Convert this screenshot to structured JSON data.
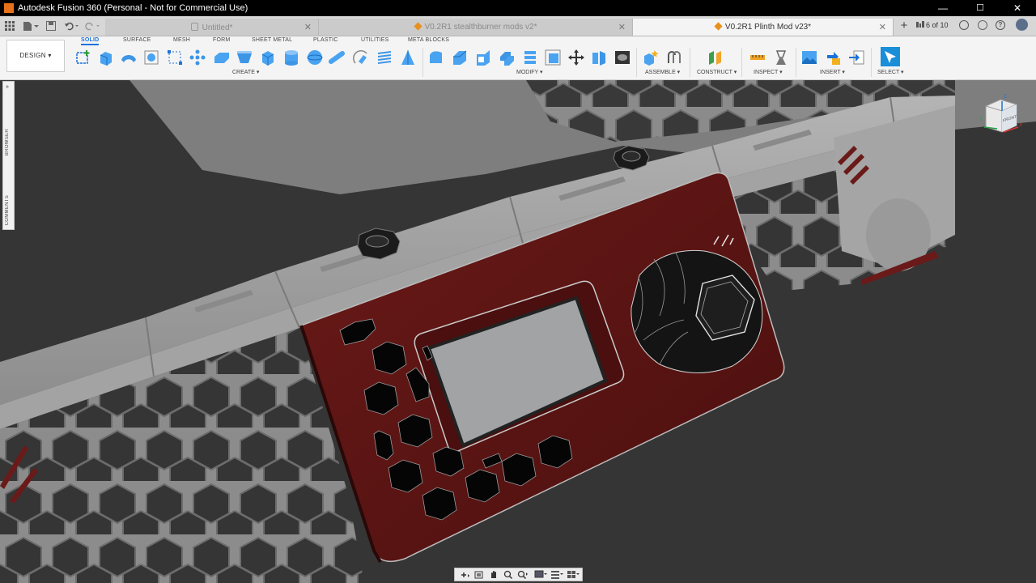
{
  "window": {
    "title": "Autodesk Fusion 360 (Personal - Not for Commercial Use)",
    "controls": {
      "minimize": "—",
      "maximize": "☐",
      "close": "✕"
    }
  },
  "tabbar": {
    "tabs": [
      {
        "label": "Untitled*",
        "icon": "lock-icon",
        "active": false
      },
      {
        "label": "V0.2R1 stealthburner mods v2*",
        "icon": "component-icon",
        "active": false
      },
      {
        "label": "V0.2R1 Plinth Mod v23*",
        "icon": "component-icon",
        "active": true
      }
    ],
    "close_glyph": "✕",
    "new_tab_glyph": "+",
    "job_status": "6 of 10"
  },
  "ribbon": {
    "workspace": "DESIGN ▾",
    "tabs": [
      "SOLID",
      "SURFACE",
      "MESH",
      "FORM",
      "SHEET METAL",
      "PLASTIC",
      "UTILITIES",
      "META BLOCKS"
    ],
    "active_tab": "SOLID",
    "groups": [
      "CREATE ▾",
      "MODIFY ▾",
      "ASSEMBLE ▾",
      "CONSTRUCT ▾",
      "INSPECT ▾",
      "INSERT ▾",
      "SELECT ▾"
    ]
  },
  "panels": {
    "browser": "BROWSER",
    "comments": "COMMENTS"
  },
  "viewcube": {
    "face": "FRONT",
    "axes": [
      "X",
      "Y",
      "Z"
    ]
  },
  "colors": {
    "accent": "#1b73d9",
    "plinth": "#5a1414",
    "frame": "#8e8e8e",
    "background": "#353535"
  }
}
